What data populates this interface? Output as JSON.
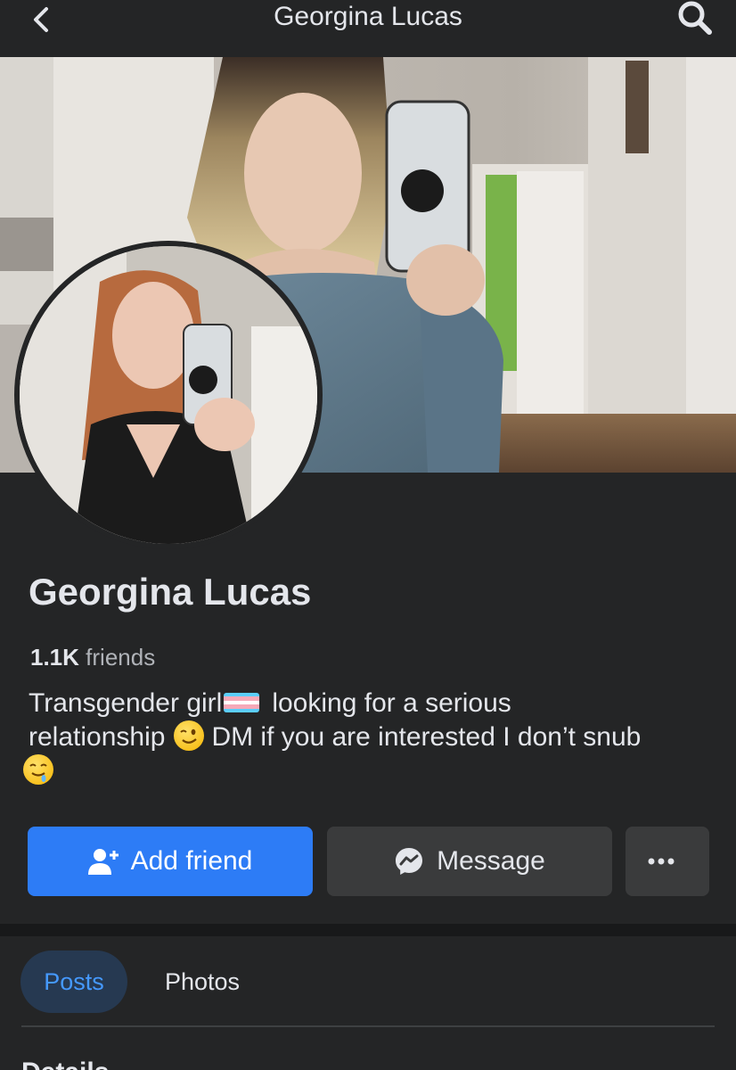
{
  "header": {
    "title": "Georgina Lucas",
    "back_icon": "chevron-left-icon",
    "search_icon": "search-icon"
  },
  "profile": {
    "name": "Georgina Lucas",
    "friends_count": "1.1K",
    "friends_label": "friends",
    "bio_part1": "Transgender girl",
    "bio_part2": "looking for a serious",
    "bio_part3": "relationship",
    "bio_part4": "DM if you are interested I don’t snub",
    "flag_colors": [
      "#5bcefa",
      "#f5a9b8",
      "#ffffff",
      "#f5a9b8",
      "#5bcefa"
    ]
  },
  "actions": {
    "add_friend_label": "Add friend",
    "message_label": "Message",
    "more_icon": "ellipsis-icon"
  },
  "tabs": [
    {
      "label": "Posts",
      "active": true
    },
    {
      "label": "Photos",
      "active": false
    }
  ],
  "section": {
    "details_label": "Details"
  },
  "colors": {
    "background": "#242526",
    "primary_button": "#2d7cf6",
    "secondary_button": "#3a3b3c",
    "active_tab_bg": "#263951",
    "active_tab_text": "#4599ff"
  }
}
